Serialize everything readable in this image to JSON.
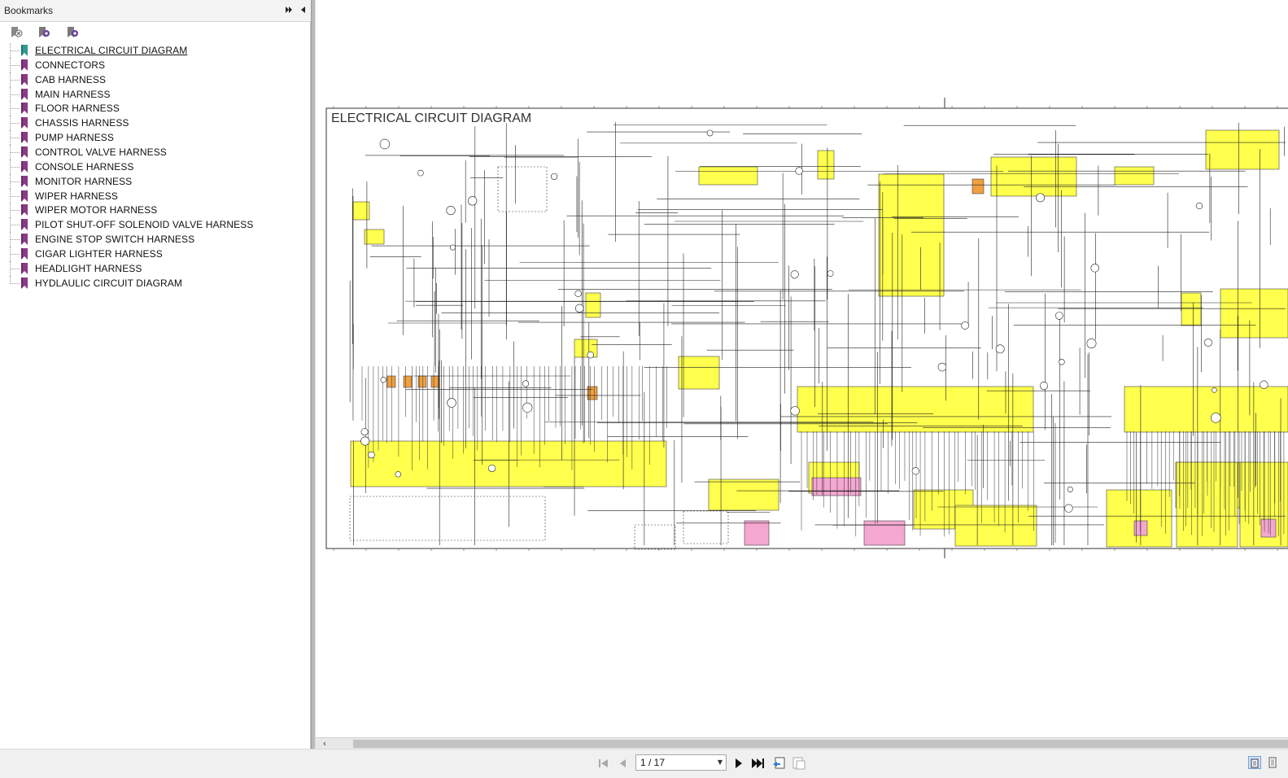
{
  "sidebar": {
    "title": "Bookmarks",
    "expand_icon": "double-arrow-right-icon",
    "collapse_icon": "arrow-left-icon",
    "toolbar_icons": [
      "delete-bookmark-icon",
      "add-bookmark-icon",
      "add-child-bookmark-icon"
    ],
    "items": [
      {
        "label": "ELECTRICAL CIRCUIT DIAGRAM",
        "active": true
      },
      {
        "label": "CONNECTORS"
      },
      {
        "label": "CAB HARNESS"
      },
      {
        "label": "MAIN HARNESS"
      },
      {
        "label": "FLOOR HARNESS"
      },
      {
        "label": "CHASSIS HARNESS"
      },
      {
        "label": "PUMP HARNESS"
      },
      {
        "label": "CONTROL VALVE HARNESS"
      },
      {
        "label": "CONSOLE HARNESS"
      },
      {
        "label": "MONITOR HARNESS"
      },
      {
        "label": "WIPER HARNESS"
      },
      {
        "label": "WIPER MOTOR HARNESS"
      },
      {
        "label": "PILOT SHUT-OFF SOLENOID VALVE HARNESS"
      },
      {
        "label": "ENGINE STOP SWITCH HARNESS"
      },
      {
        "label": "CIGAR LIGHTER HARNESS"
      },
      {
        "label": "HEADLIGHT HARNESS"
      },
      {
        "label": "HYDLAULIC CIRCUIT DIAGRAM"
      }
    ]
  },
  "document": {
    "diagram_title": "ELECTRICAL CIRCUIT DIAGRAM",
    "highlight_color": "#ffff4d",
    "pink_color": "#f4a7d0",
    "orange_color": "#f0a040"
  },
  "navbar": {
    "page_display": "1 / 17",
    "buttons": [
      "first-page-icon",
      "prev-page-icon",
      "next-page-icon",
      "last-page-icon",
      "previous-view-icon",
      "next-view-icon"
    ],
    "view_modes": [
      "single-page-icon",
      "continuous-icon"
    ]
  },
  "colors": {
    "active_bookmark": "#2f9a92",
    "bookmark": "#8a3a86"
  }
}
